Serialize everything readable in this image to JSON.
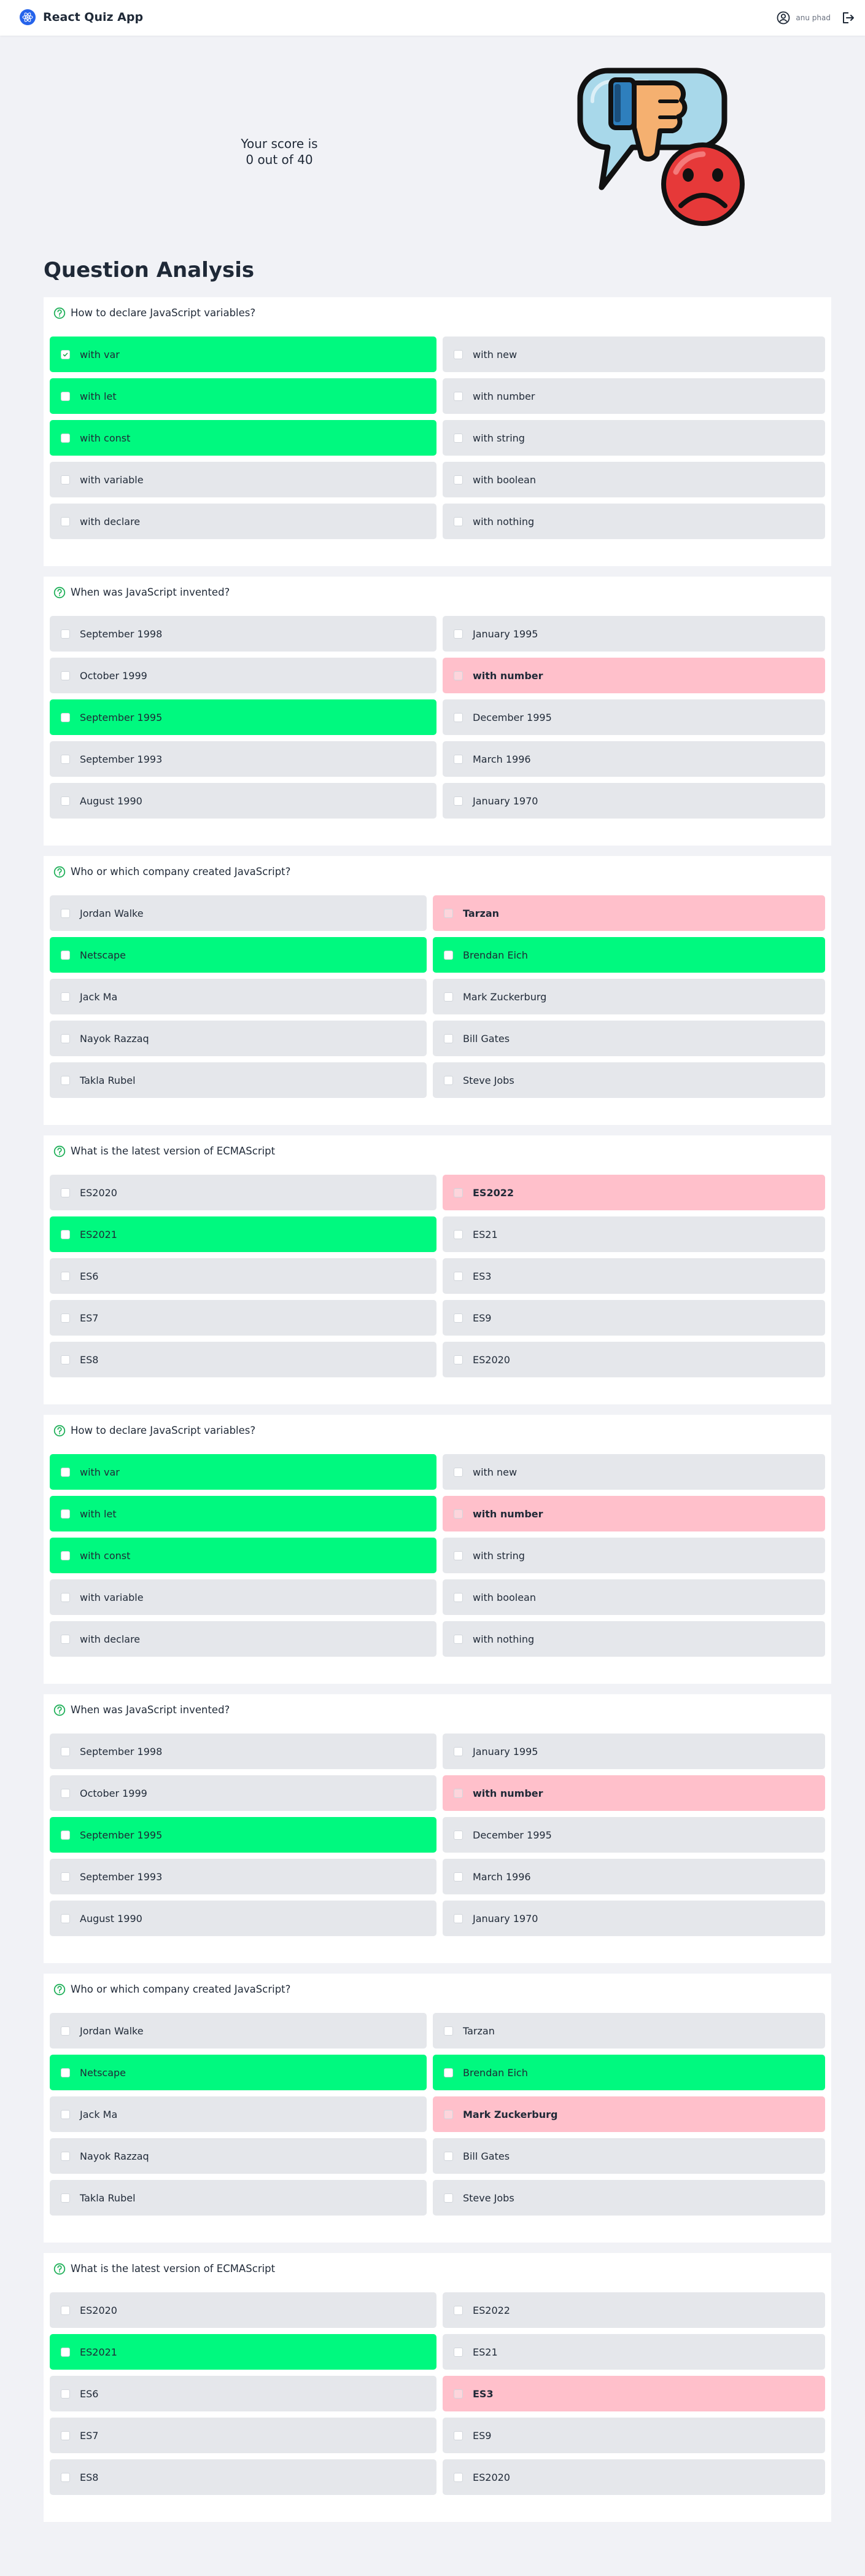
{
  "app": {
    "title": "React Quiz App",
    "user": "anu phad"
  },
  "score": {
    "line1": "Your score is",
    "line2": "0 out of 40"
  },
  "analysis": {
    "title": "Question Analysis"
  },
  "colors": {
    "correct": "#00f97f",
    "wrong": "#ffc0cb",
    "neutral": "#e5e7eb",
    "accent": "#2563eb"
  },
  "questions": [
    {
      "text": "How to declare JavaScript variables?",
      "layout": "b",
      "options": [
        {
          "label": "with var",
          "status": "correct",
          "checked": true
        },
        {
          "label": "with new",
          "status": "neutral"
        },
        {
          "label": "with let",
          "status": "correct"
        },
        {
          "label": "with number",
          "status": "neutral"
        },
        {
          "label": "with const",
          "status": "correct"
        },
        {
          "label": "with string",
          "status": "neutral"
        },
        {
          "label": "with variable",
          "status": "neutral"
        },
        {
          "label": "with boolean",
          "status": "neutral"
        },
        {
          "label": "with declare",
          "status": "neutral"
        },
        {
          "label": "with nothing",
          "status": "neutral"
        }
      ]
    },
    {
      "text": "When was JavaScript invented?",
      "layout": "a",
      "options": [
        {
          "label": "September 1998",
          "status": "neutral"
        },
        {
          "label": "January 1995",
          "status": "neutral"
        },
        {
          "label": "October 1999",
          "status": "neutral"
        },
        {
          "label": "with number",
          "status": "wrong"
        },
        {
          "label": "September 1995",
          "status": "correct"
        },
        {
          "label": "December 1995",
          "status": "neutral"
        },
        {
          "label": "September 1993",
          "status": "neutral"
        },
        {
          "label": "March 1996",
          "status": "neutral"
        },
        {
          "label": "August 1990",
          "status": "neutral"
        },
        {
          "label": "January 1970",
          "status": "neutral"
        }
      ]
    },
    {
      "text": "Who or which company created JavaScript?",
      "layout": "c",
      "options": [
        {
          "label": "Jordan Walke",
          "status": "neutral"
        },
        {
          "label": "Tarzan",
          "status": "wrong"
        },
        {
          "label": "Netscape",
          "status": "correct"
        },
        {
          "label": "Brendan Eich",
          "status": "correct"
        },
        {
          "label": "Jack Ma",
          "status": "neutral"
        },
        {
          "label": "Mark Zuckerburg",
          "status": "neutral"
        },
        {
          "label": "Nayok Razzaq",
          "status": "neutral"
        },
        {
          "label": "Bill Gates",
          "status": "neutral"
        },
        {
          "label": "Takla Rubel",
          "status": "neutral"
        },
        {
          "label": "Steve Jobs",
          "status": "neutral"
        }
      ]
    },
    {
      "text": "What is the latest version of ECMAScript",
      "layout": "b",
      "options": [
        {
          "label": "ES2020",
          "status": "neutral"
        },
        {
          "label": "ES2022",
          "status": "wrong"
        },
        {
          "label": "ES2021",
          "status": "correct"
        },
        {
          "label": "ES21",
          "status": "neutral"
        },
        {
          "label": "ES6",
          "status": "neutral"
        },
        {
          "label": "ES3",
          "status": "neutral"
        },
        {
          "label": "ES7",
          "status": "neutral"
        },
        {
          "label": "ES9",
          "status": "neutral"
        },
        {
          "label": "ES8",
          "status": "neutral"
        },
        {
          "label": "ES2020",
          "status": "neutral"
        }
      ]
    },
    {
      "text": "How to declare JavaScript variables?",
      "layout": "b",
      "options": [
        {
          "label": "with var",
          "status": "correct"
        },
        {
          "label": "with new",
          "status": "neutral"
        },
        {
          "label": "with let",
          "status": "correct"
        },
        {
          "label": "with number",
          "status": "wrong"
        },
        {
          "label": "with const",
          "status": "correct"
        },
        {
          "label": "with string",
          "status": "neutral"
        },
        {
          "label": "with variable",
          "status": "neutral"
        },
        {
          "label": "with boolean",
          "status": "neutral"
        },
        {
          "label": "with declare",
          "status": "neutral"
        },
        {
          "label": "with nothing",
          "status": "neutral"
        }
      ]
    },
    {
      "text": "When was JavaScript invented?",
      "layout": "a",
      "options": [
        {
          "label": "September 1998",
          "status": "neutral"
        },
        {
          "label": "January 1995",
          "status": "neutral"
        },
        {
          "label": "October 1999",
          "status": "neutral"
        },
        {
          "label": "with number",
          "status": "wrong"
        },
        {
          "label": "September 1995",
          "status": "correct"
        },
        {
          "label": "December 1995",
          "status": "neutral"
        },
        {
          "label": "September 1993",
          "status": "neutral"
        },
        {
          "label": "March 1996",
          "status": "neutral"
        },
        {
          "label": "August 1990",
          "status": "neutral"
        },
        {
          "label": "January 1970",
          "status": "neutral"
        }
      ]
    },
    {
      "text": "Who or which company created JavaScript?",
      "layout": "c",
      "options": [
        {
          "label": "Jordan Walke",
          "status": "neutral"
        },
        {
          "label": "Tarzan",
          "status": "neutral"
        },
        {
          "label": "Netscape",
          "status": "correct"
        },
        {
          "label": "Brendan Eich",
          "status": "correct"
        },
        {
          "label": "Jack Ma",
          "status": "neutral"
        },
        {
          "label": "Mark Zuckerburg",
          "status": "wrong"
        },
        {
          "label": "Nayok Razzaq",
          "status": "neutral"
        },
        {
          "label": "Bill Gates",
          "status": "neutral"
        },
        {
          "label": "Takla Rubel",
          "status": "neutral"
        },
        {
          "label": "Steve Jobs",
          "status": "neutral"
        }
      ]
    },
    {
      "text": "What is the latest version of ECMAScript",
      "layout": "b",
      "options": [
        {
          "label": "ES2020",
          "status": "neutral"
        },
        {
          "label": "ES2022",
          "status": "neutral"
        },
        {
          "label": "ES2021",
          "status": "correct"
        },
        {
          "label": "ES21",
          "status": "neutral"
        },
        {
          "label": "ES6",
          "status": "neutral"
        },
        {
          "label": "ES3",
          "status": "wrong"
        },
        {
          "label": "ES7",
          "status": "neutral"
        },
        {
          "label": "ES9",
          "status": "neutral"
        },
        {
          "label": "ES8",
          "status": "neutral"
        },
        {
          "label": "ES2020",
          "status": "neutral"
        }
      ]
    }
  ]
}
